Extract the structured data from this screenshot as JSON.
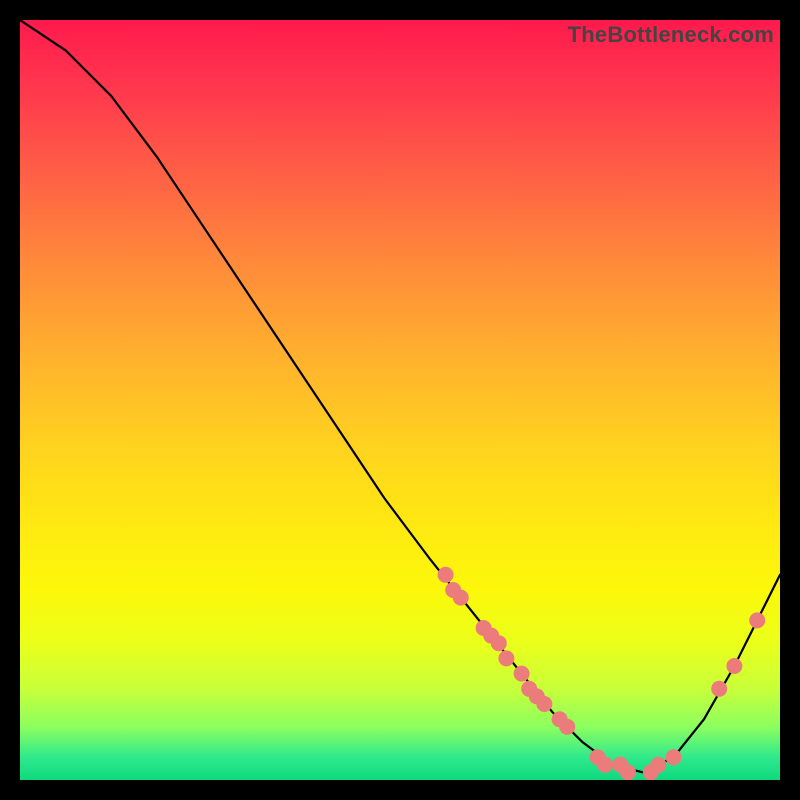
{
  "watermark": "TheBottleneck.com",
  "colors": {
    "curve_stroke": "#000000",
    "marker_fill": "#ec7b7b",
    "marker_stroke": "#ec7b7b",
    "gradient_top": "#ff1a4d",
    "gradient_bottom": "#0ed97e",
    "frame_bg": "#000000"
  },
  "chart_data": {
    "type": "line",
    "title": "",
    "xlabel": "",
    "ylabel": "",
    "xlim": [
      0,
      100
    ],
    "ylim": [
      0,
      100
    ],
    "grid": false,
    "legend": false,
    "series": [
      {
        "name": "bottleneck-curve",
        "x": [
          0,
          6,
          12,
          18,
          24,
          30,
          36,
          42,
          48,
          54,
          58,
          62,
          66,
          70,
          74,
          78,
          82,
          86,
          90,
          94,
          98,
          100
        ],
        "y": [
          100,
          96,
          90,
          82,
          73,
          64,
          55,
          46,
          37,
          29,
          24,
          19,
          14,
          9,
          5,
          2,
          1,
          3,
          8,
          15,
          23,
          27
        ]
      }
    ],
    "markers": [
      {
        "name": "cluster-upper-a",
        "x": 56,
        "y": 27
      },
      {
        "name": "cluster-upper-b",
        "x": 57,
        "y": 25
      },
      {
        "name": "cluster-upper-c",
        "x": 58,
        "y": 24
      },
      {
        "name": "cluster-mid-a",
        "x": 61,
        "y": 20
      },
      {
        "name": "cluster-mid-b",
        "x": 62,
        "y": 19
      },
      {
        "name": "cluster-mid-c",
        "x": 63,
        "y": 18
      },
      {
        "name": "cluster-mid-d",
        "x": 64,
        "y": 16
      },
      {
        "name": "cluster-low-a",
        "x": 66,
        "y": 14
      },
      {
        "name": "cluster-low-b",
        "x": 67,
        "y": 12
      },
      {
        "name": "cluster-low-c",
        "x": 68,
        "y": 11
      },
      {
        "name": "cluster-low-d",
        "x": 69,
        "y": 10
      },
      {
        "name": "pre-trough-a",
        "x": 71,
        "y": 8
      },
      {
        "name": "pre-trough-b",
        "x": 72,
        "y": 7
      },
      {
        "name": "trough-a",
        "x": 76,
        "y": 3
      },
      {
        "name": "trough-b",
        "x": 77,
        "y": 2
      },
      {
        "name": "trough-c",
        "x": 79,
        "y": 2
      },
      {
        "name": "trough-d",
        "x": 80,
        "y": 1
      },
      {
        "name": "trough-e",
        "x": 83,
        "y": 1
      },
      {
        "name": "trough-f",
        "x": 84,
        "y": 2
      },
      {
        "name": "rise-a",
        "x": 86,
        "y": 3
      },
      {
        "name": "rise-b",
        "x": 92,
        "y": 12
      },
      {
        "name": "rise-c",
        "x": 94,
        "y": 15
      },
      {
        "name": "rise-d",
        "x": 97,
        "y": 21
      }
    ]
  }
}
